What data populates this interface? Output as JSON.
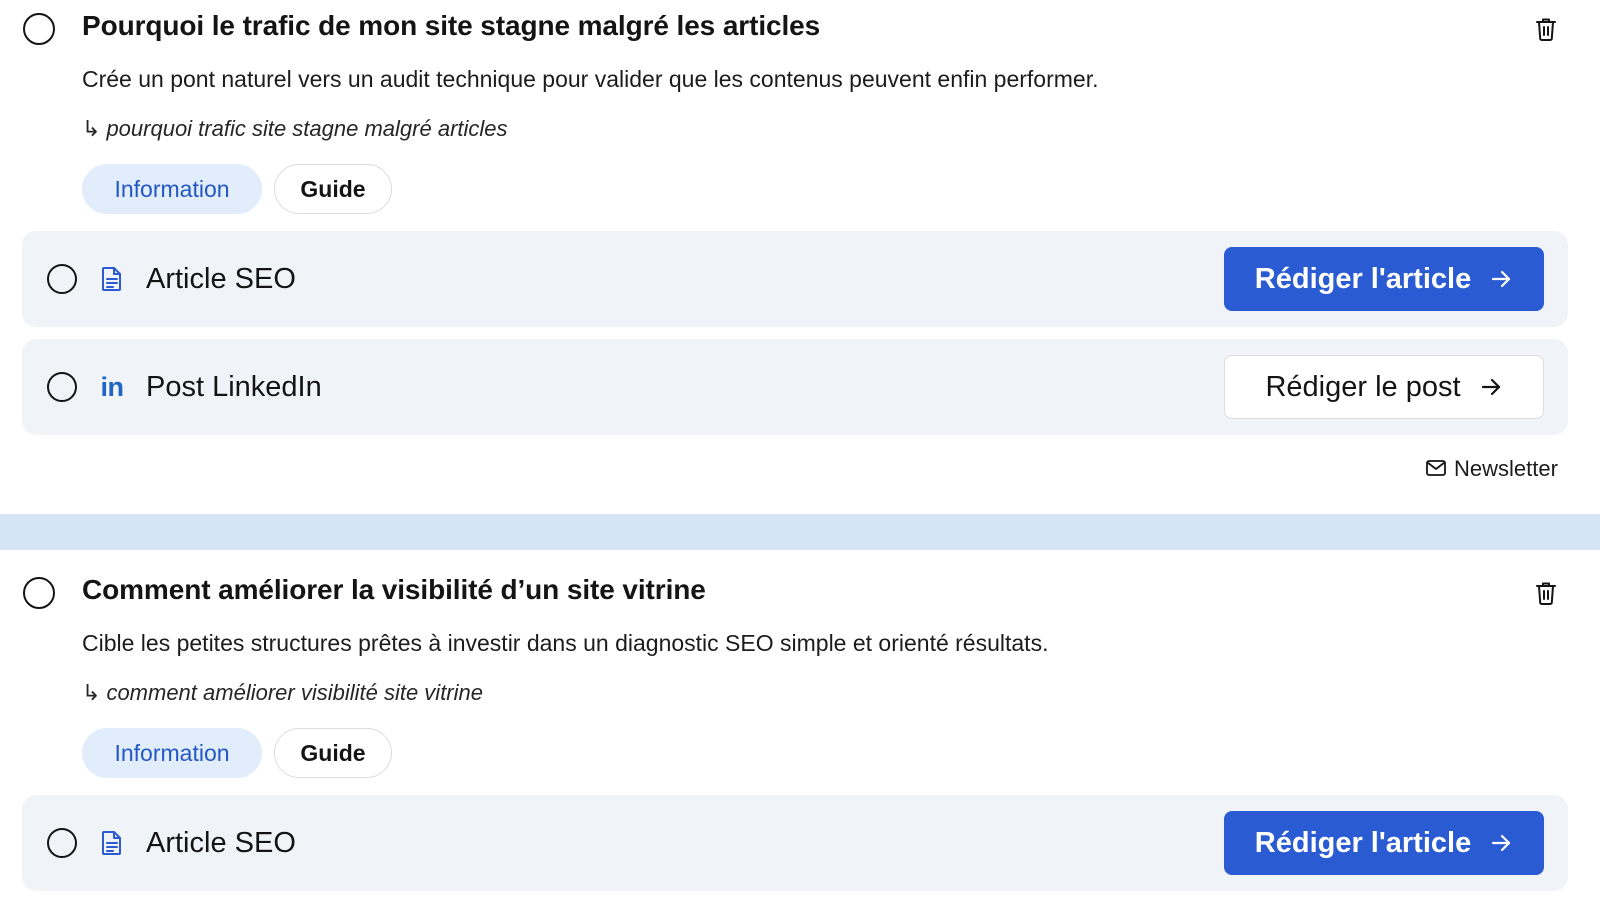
{
  "items": [
    {
      "title": "Pourquoi le trafic de mon site stagne malgré les articles",
      "description": "Crée un pont naturel vers un audit technique pour valider que les contenus peuvent enfin performer.",
      "keyword_arrow": "↳",
      "keyword": "pourquoi trafic site stagne malgré articles",
      "tags": [
        "Information",
        "Guide"
      ],
      "tasks": [
        {
          "icon": "document-icon",
          "label": "Article SEO",
          "button": "Rédiger l'article"
        },
        {
          "icon": "linkedin-icon",
          "label": "Post LinkedIn",
          "button": "Rédiger le post"
        }
      ],
      "extra": {
        "icon": "mail-icon",
        "label": "Newsletter"
      }
    },
    {
      "title": "Comment améliorer la visibilité d’un site vitrine",
      "description": "Cible les petites structures prêtes à investir dans un diagnostic SEO simple et orienté résultats.",
      "keyword_arrow": "↳",
      "keyword": "comment améliorer visibilité site vitrine",
      "tags": [
        "Information",
        "Guide"
      ],
      "tasks": [
        {
          "icon": "document-icon",
          "label": "Article SEO",
          "button": "Rédiger l'article"
        }
      ]
    }
  ],
  "linkedin_glyph": "in",
  "colors": {
    "primary": "#2a5bd3",
    "tag_info_bg": "#e1edfb",
    "tag_info_text": "#2457c5",
    "task_bg": "#f0f3f8",
    "separator": "#d6e4f7",
    "linkedin": "#1f66c2"
  }
}
